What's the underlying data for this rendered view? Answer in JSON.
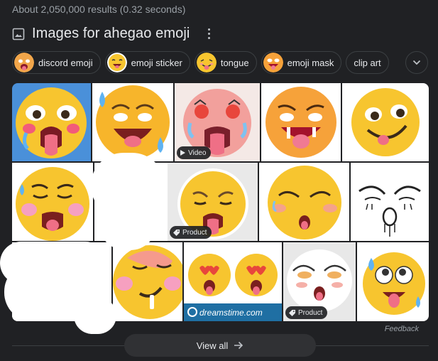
{
  "results_stats": "About 2,050,000 results (0.32 seconds)",
  "header": {
    "title": "Images for ahegao emoji"
  },
  "chips": [
    {
      "label": "discord emoji"
    },
    {
      "label": "emoji sticker"
    },
    {
      "label": "tongue"
    },
    {
      "label": "emoji mask"
    },
    {
      "label": "clip art"
    }
  ],
  "badges": {
    "video": "Video",
    "product": "Product"
  },
  "watermark": "dreamstime.com",
  "feedback": "Feedback",
  "view_all": "View all",
  "icons": [
    "image-icon",
    "more-vert-icon",
    "chevron-down-icon",
    "play-icon",
    "tag-icon",
    "arrow-right-icon"
  ],
  "colors": {
    "background": "#202124",
    "chip_border": "#3c4043",
    "button_bg": "#303134",
    "emoji_yellow": "#f7c52f"
  }
}
